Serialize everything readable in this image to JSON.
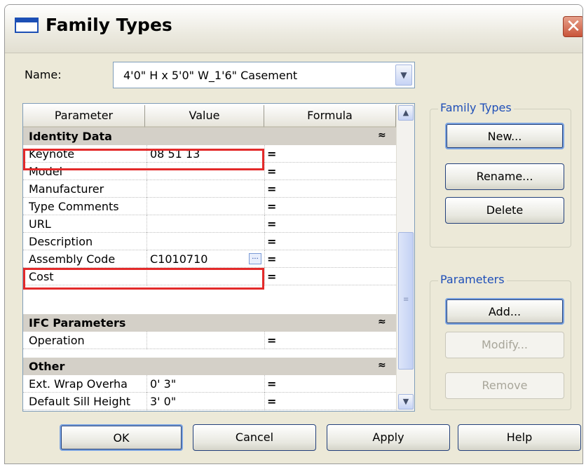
{
  "window": {
    "title": "Family Types",
    "close_glyph": "✕"
  },
  "name_field": {
    "label": "Name:",
    "value": "4'0\" H x 5'0\" W_1'6\" Casement"
  },
  "grid": {
    "headers": {
      "parameter": "Parameter",
      "value": "Value",
      "formula": "Formula"
    },
    "groups": {
      "identity": "Identity Data",
      "ifc": "IFC Parameters",
      "other": "Other"
    },
    "rows": [
      {
        "param": "Keynote",
        "value": "08 51 13",
        "formula": "="
      },
      {
        "param": "Model",
        "value": "",
        "formula": "="
      },
      {
        "param": "Manufacturer",
        "value": "",
        "formula": "="
      },
      {
        "param": "Type Comments",
        "value": "",
        "formula": "="
      },
      {
        "param": "URL",
        "value": "",
        "formula": "="
      },
      {
        "param": "Description",
        "value": "",
        "formula": "="
      },
      {
        "param": "Assembly Code",
        "value": "C1010710",
        "formula": "="
      },
      {
        "param": "Cost",
        "value": "",
        "formula": "="
      },
      {
        "param": "Operation",
        "value": "",
        "formula": "="
      },
      {
        "param": "Ext. Wrap Overha",
        "value": "0'  3\"",
        "formula": "="
      },
      {
        "param": "Default Sill Height",
        "value": "3'  0\"",
        "formula": "="
      }
    ],
    "collapse_glyph": "≈",
    "ellipsis_glyph": "..."
  },
  "family_types_group": {
    "title": "Family Types",
    "new": "New...",
    "rename": "Rename...",
    "delete": "Delete"
  },
  "parameters_group": {
    "title": "Parameters",
    "add": "Add...",
    "modify": "Modify...",
    "remove": "Remove"
  },
  "footer": {
    "ok": "OK",
    "cancel": "Cancel",
    "apply": "Apply",
    "help": "Help"
  },
  "colors": {
    "highlight": "#e32a2a",
    "group_bg": "#d4d0c8",
    "dialog_bg": "#ece9d8",
    "group_title": "#1f4fb8"
  }
}
